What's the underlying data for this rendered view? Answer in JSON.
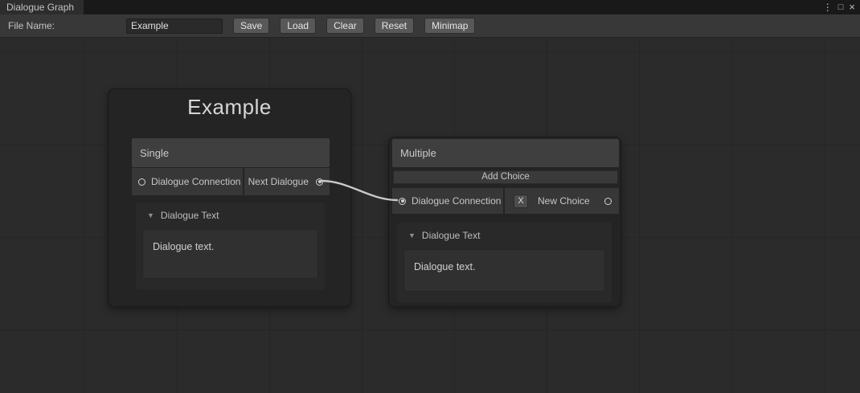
{
  "window": {
    "title": "Dialogue Graph",
    "icons": {
      "menu": "⋮",
      "maximize": "□",
      "close": "×"
    }
  },
  "toolbar": {
    "file_name_label": "File Name:",
    "file_name_value": "Example",
    "buttons": [
      "Save",
      "Load",
      "Clear",
      "Reset",
      "Minimap"
    ]
  },
  "nodes": {
    "single": {
      "title": "Example",
      "header": "Single",
      "input_port": {
        "label": "Dialogue Connection",
        "connected": false
      },
      "output_port": {
        "label": "Next Dialogue",
        "connected": true
      },
      "foldout": {
        "icon": "▼",
        "label": "Dialogue Text",
        "text": "Dialogue text."
      }
    },
    "multiple": {
      "header": "Multiple",
      "add_choice_label": "Add Choice",
      "input_port": {
        "label": "Dialogue Connection",
        "connected": true
      },
      "choice": {
        "delete_label": "X",
        "name": "New Choice",
        "connected": false
      },
      "foldout": {
        "icon": "▼",
        "label": "Dialogue Text",
        "text": "Dialogue text."
      }
    }
  },
  "edges": [
    {
      "from": "Single / Next Dialogue",
      "to": "Multiple / Dialogue Connection"
    }
  ],
  "colors": {
    "canvas": "#2b2b2b",
    "node": "#242424",
    "section_header": "#3f3f3f",
    "edge": "#c9c9c9",
    "port": "#d2d2d2"
  }
}
